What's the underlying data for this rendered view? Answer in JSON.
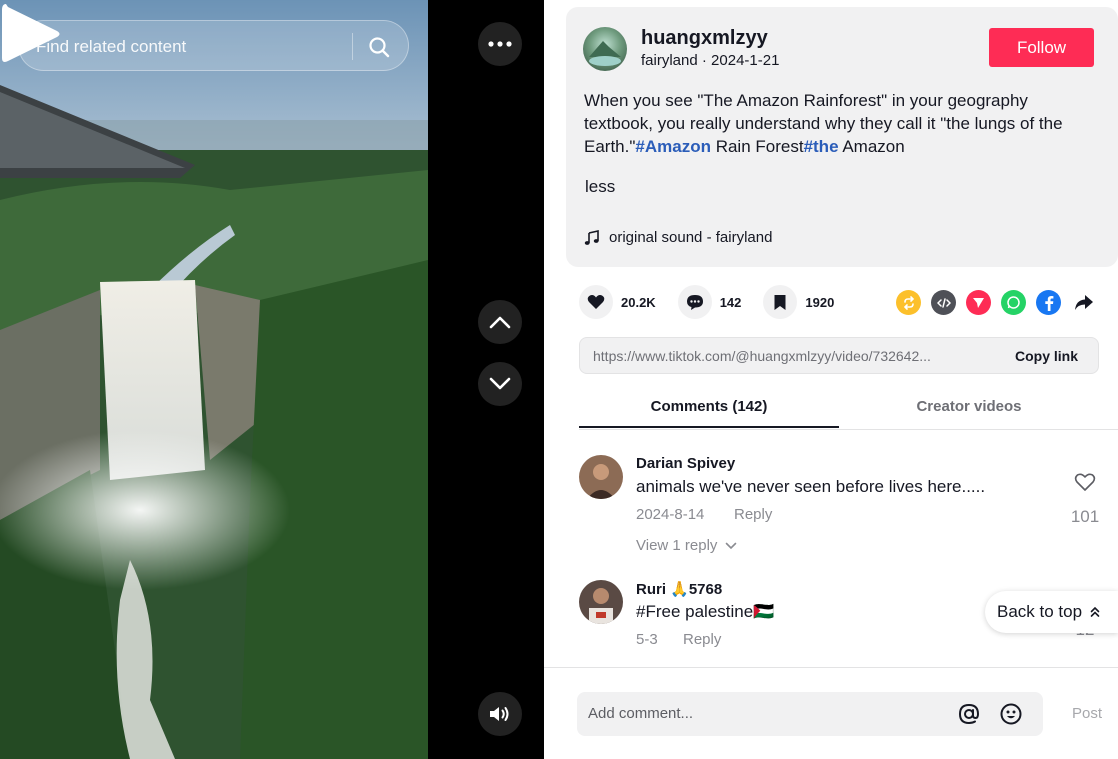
{
  "video": {
    "search_placeholder": "Find related content"
  },
  "post": {
    "username": "huangxmlzyy",
    "nickname": "fairyland",
    "date": "2024-1-21",
    "follow_label": "Follow",
    "description_parts": {
      "text1": "When you see \"The Amazon Rainforest\" in your geography textbook, you really understand why they call it \"the lungs of the Earth.\"",
      "tag1": "#Amazon",
      "text2": " Rain Forest",
      "tag2": "#the",
      "text3": " Amazon"
    },
    "less_label": "less",
    "sound": "original sound - fairyland"
  },
  "stats": {
    "likes": "20.2K",
    "comments": "142",
    "saves": "1920"
  },
  "share_icons": [
    "repost-icon",
    "embed-icon",
    "send-icon",
    "whatsapp-icon",
    "facebook-icon",
    "share-arrow-icon"
  ],
  "link": {
    "url": "https://www.tiktok.com/@huangxmlzyy/video/732642...",
    "copy_label": "Copy link"
  },
  "tabs": {
    "comments": "Comments (142)",
    "creator": "Creator videos"
  },
  "comments": [
    {
      "name": "Darian Spivey",
      "text": "animals we've never seen before lives here.....",
      "date": "2024-8-14",
      "reply_label": "Reply",
      "likes": "101",
      "view_replies": "View 1 reply"
    },
    {
      "name": "Ruri 🙏5768",
      "text": "#Free palestine🇵🇸",
      "date": "5-3",
      "reply_label": "Reply",
      "likes": "12"
    }
  ],
  "back_to_top": "Back to top",
  "composer": {
    "placeholder": "Add comment...",
    "post_label": "Post"
  },
  "colors": {
    "follow": "#fe2c55",
    "hashtag": "#2b5db9",
    "panel_bg": "#f1f1f2"
  }
}
